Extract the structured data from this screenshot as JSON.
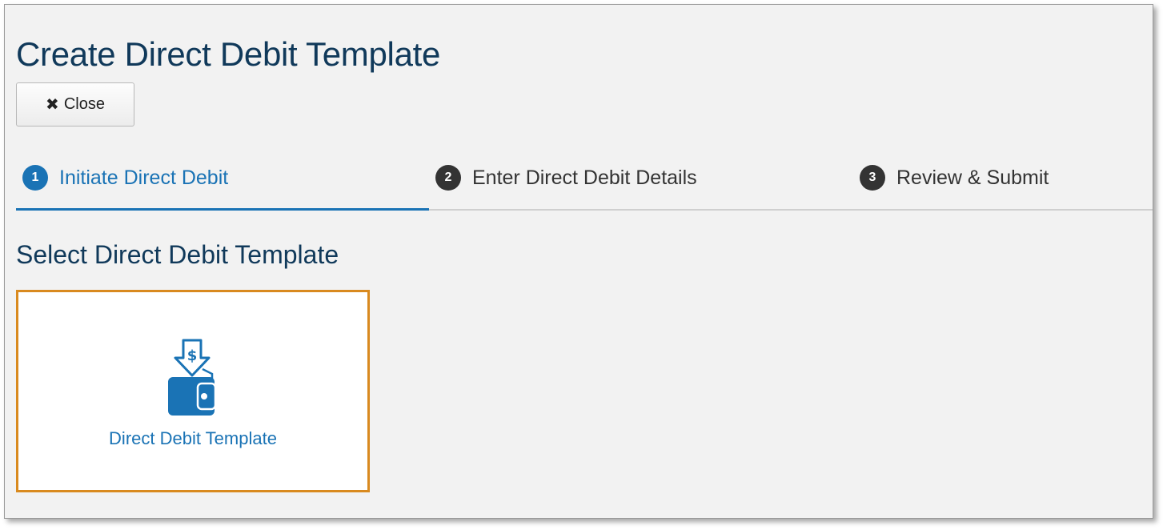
{
  "page": {
    "title": "Create Direct Debit Template"
  },
  "toolbar": {
    "close_label": "Close",
    "close_icon": "close-icon"
  },
  "steps": [
    {
      "number": "1",
      "label": "Initiate Direct Debit",
      "active": true
    },
    {
      "number": "2",
      "label": "Enter Direct Debit Details",
      "active": false
    },
    {
      "number": "3",
      "label": "Review & Submit",
      "active": false
    }
  ],
  "section": {
    "title": "Select Direct Debit Template"
  },
  "templates": [
    {
      "label": "Direct Debit Template",
      "icon": "wallet-dollar-icon",
      "selected": true
    }
  ],
  "colors": {
    "accent": "#1a73b5",
    "title": "#10395a",
    "selection_border": "#d98a1f",
    "background": "#f2f2f2"
  }
}
